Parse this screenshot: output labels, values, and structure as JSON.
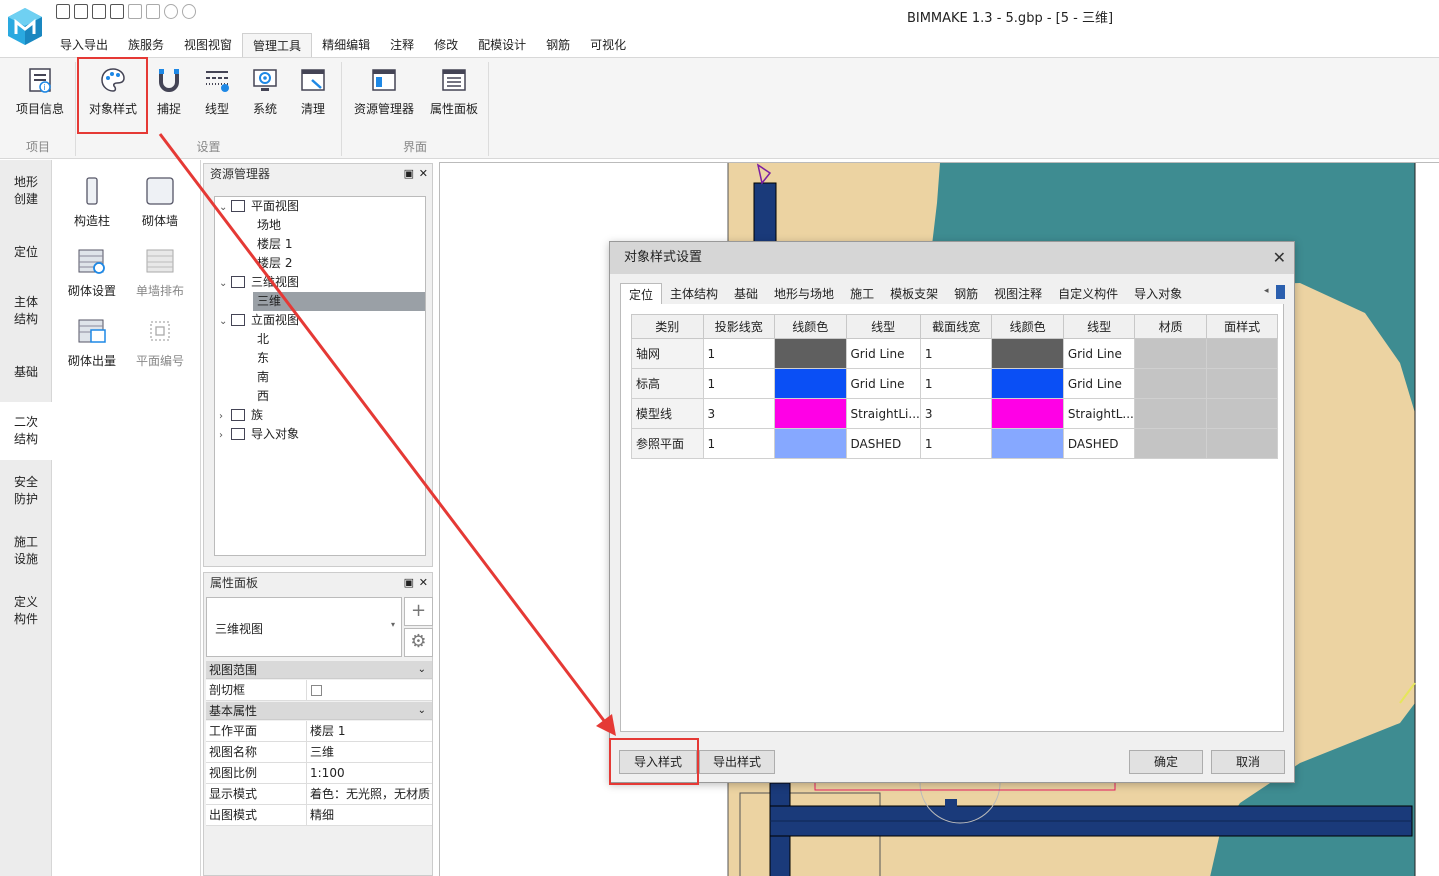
{
  "app": {
    "title": "BIMMAKE 1.3 - 5.gbp - [5 - 三维]"
  },
  "menu": [
    "导入导出",
    "族服务",
    "视图视窗",
    "管理工具",
    "精细编辑",
    "注释",
    "修改",
    "配模设计",
    "钢筋",
    "可视化"
  ],
  "menu_active": "管理工具",
  "ribbon": {
    "buttons": {
      "project_info": "项目信息",
      "object_style": "对象样式",
      "snap": "捕捉",
      "linetype": "线型",
      "system": "系统",
      "clear": "清理",
      "resource_manager": "资源管理器",
      "property_panel": "属性面板"
    },
    "groups": {
      "project": "项目",
      "settings": "设置",
      "interface": "界面"
    }
  },
  "left_tabs": [
    "地形\n创建",
    "定位",
    "主体\n结构",
    "基础",
    "二次\n结构",
    "安全\n防护",
    "施工\n设施",
    "定义\n构件"
  ],
  "left_tab_active": "二次\n结构",
  "tools": {
    "t1": "构造柱",
    "t2": "砌体墙",
    "t3": "砌体设置",
    "t4": "单墙排布",
    "t5": "砌体出量",
    "t6": "平面编号"
  },
  "resource_manager": {
    "title": "资源管理器",
    "tree": {
      "plan_view": "平面视图",
      "site": "场地",
      "level1": "楼层 1",
      "level2": "楼层 2",
      "view3d": "三维视图",
      "view3d_item": "三维",
      "elevation": "立面视图",
      "north": "北",
      "east": "东",
      "south": "南",
      "west": "西",
      "family": "族",
      "imported": "导入对象"
    }
  },
  "property_panel": {
    "title": "属性面板",
    "type": "三维视图",
    "groups": {
      "view_range": "视图范围",
      "basic": "基本属性"
    },
    "rows": {
      "crop": {
        "k": "剖切框"
      },
      "work_plane": {
        "k": "工作平面",
        "v": "楼层 1"
      },
      "view_name": {
        "k": "视图名称",
        "v": "三维"
      },
      "scale": {
        "k": "视图比例",
        "v": "1:100"
      },
      "display": {
        "k": "显示模式",
        "v": "着色：无光照，无材质"
      },
      "output": {
        "k": "出图模式",
        "v": "精细"
      }
    }
  },
  "dialog": {
    "title": "对象样式设置",
    "tabs": [
      "定位",
      "主体结构",
      "基础",
      "地形与场地",
      "施工",
      "模板支架",
      "钢筋",
      "视图注释",
      "自定义构件",
      "导入对象"
    ],
    "tab_active": "定位",
    "columns": [
      "类别",
      "投影线宽",
      "线颜色",
      "线型",
      "截面线宽",
      "线颜色",
      "线型",
      "材质",
      "面样式"
    ],
    "rows": [
      {
        "category": "轴网",
        "proj_w": "1",
        "proj_color": "#5f5f5f",
        "proj_line": "Grid Line",
        "cut_w": "1",
        "cut_color": "#5f5f5f",
        "cut_line": "Grid Line"
      },
      {
        "category": "标高",
        "proj_w": "1",
        "proj_color": "#0a4ff5",
        "proj_line": "Grid Line",
        "cut_w": "1",
        "cut_color": "#0a4ff5",
        "cut_line": "Grid Line"
      },
      {
        "category": "模型线",
        "proj_w": "3",
        "proj_color": "#ff00e6",
        "proj_line": "StraightLi...",
        "cut_w": "3",
        "cut_color": "#ff00e6",
        "cut_line": "StraightL..."
      },
      {
        "category": "参照平面",
        "proj_w": "1",
        "proj_color": "#86a8ff",
        "proj_line": "DASHED",
        "cut_w": "1",
        "cut_color": "#86a8ff",
        "cut_line": "DASHED"
      }
    ],
    "buttons": {
      "import": "导入样式",
      "export": "导出样式",
      "ok": "确定",
      "cancel": "取消"
    }
  },
  "colors": {
    "highlight": "#e53935",
    "terrain": "#3e8c91",
    "sand": "#ecd3a2",
    "beam": "#1a3a7a"
  }
}
